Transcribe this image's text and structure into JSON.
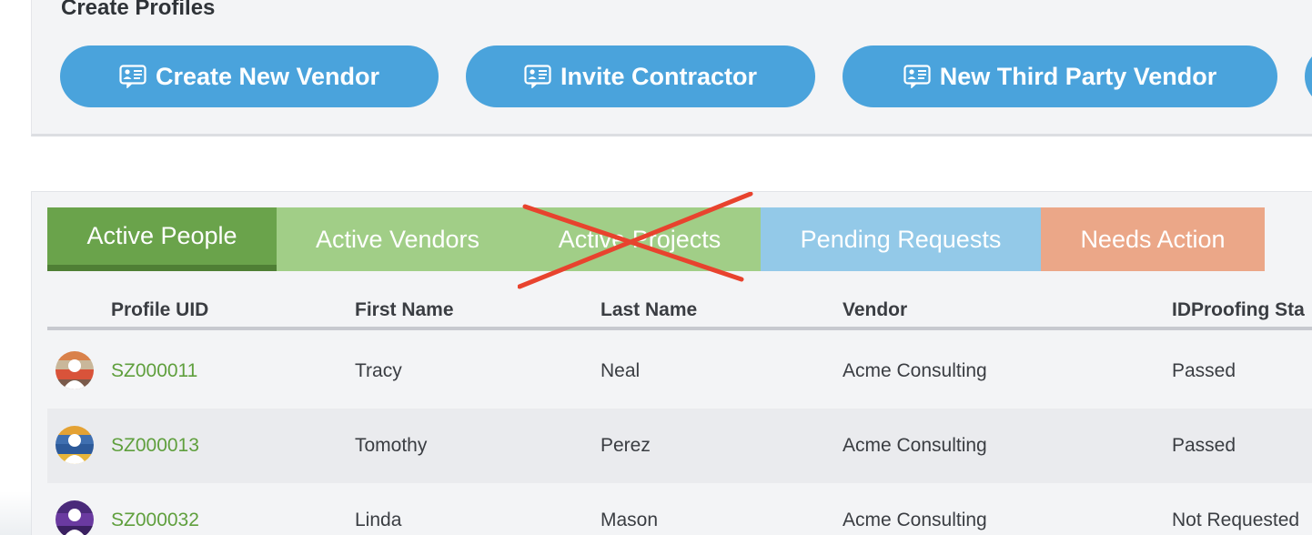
{
  "create_profiles": {
    "title": "Create Profiles",
    "buttons": [
      {
        "label": "Create New Vendor",
        "icon": "id-card-icon"
      },
      {
        "label": "Invite Contractor",
        "icon": "id-card-icon"
      },
      {
        "label": "New Third Party Vendor",
        "icon": "id-card-icon"
      }
    ]
  },
  "tabs": [
    {
      "label": "Active People",
      "color": "#6aa34b",
      "active": true
    },
    {
      "label": "Active Vendors",
      "color": "#a1ce87"
    },
    {
      "label": "Active Projects",
      "color": "#a1ce87",
      "crossed_out": true
    },
    {
      "label": "Pending Requests",
      "color": "#93c9e8"
    },
    {
      "label": "Needs Action",
      "color": "#eba788"
    }
  ],
  "table": {
    "columns": [
      "Profile UID",
      "First Name",
      "Last Name",
      "Vendor",
      "IDProofing Sta"
    ],
    "rows": [
      {
        "uid": "SZ000011",
        "first": "Tracy",
        "last": "Neal",
        "vendor": "Acme Consulting",
        "idproofing": "Passed"
      },
      {
        "uid": "SZ000013",
        "first": "Tomothy",
        "last": "Perez",
        "vendor": "Acme Consulting",
        "idproofing": "Passed"
      },
      {
        "uid": "SZ000032",
        "first": "Linda",
        "last": "Mason",
        "vendor": "Acme Consulting",
        "idproofing": "Not Requested"
      }
    ]
  },
  "colors": {
    "button_blue": "#4aa3dc",
    "link_green": "#5f9f3d",
    "cross_red": "#e8432e"
  }
}
